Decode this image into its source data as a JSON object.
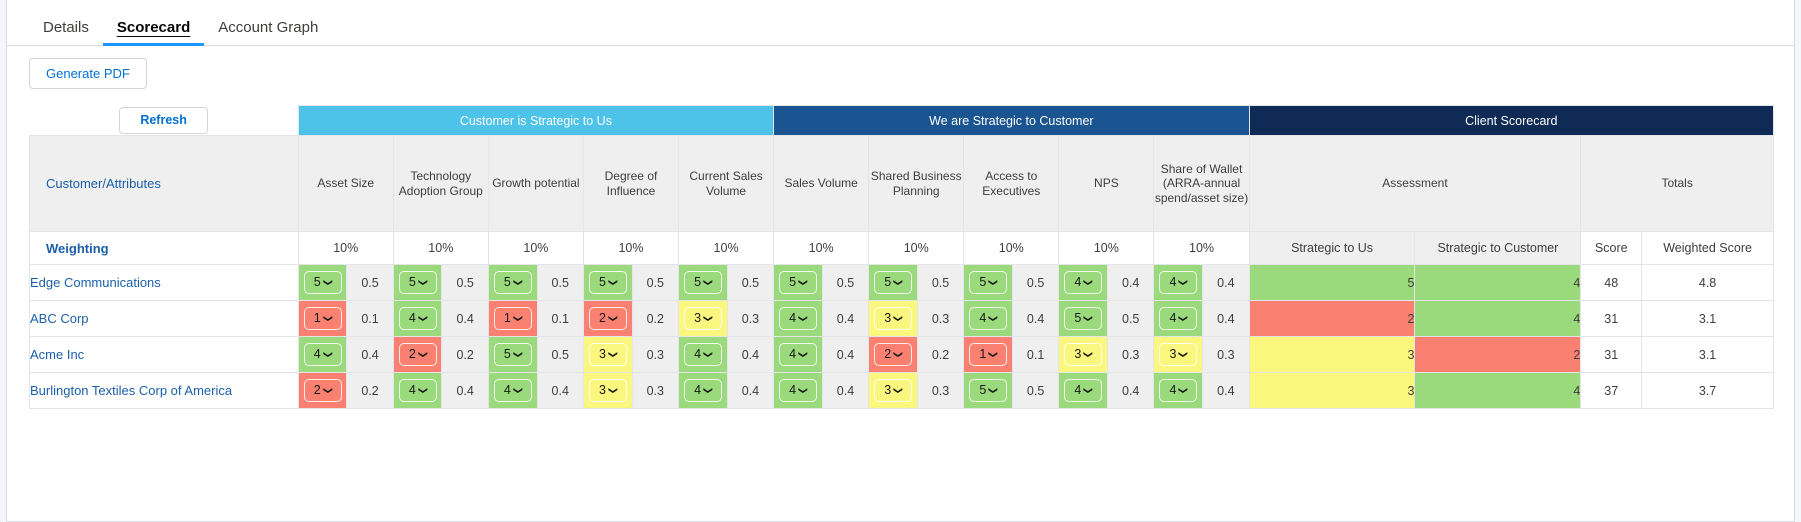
{
  "tabs": [
    {
      "label": "Details",
      "active": false
    },
    {
      "label": "Scorecard",
      "active": true
    },
    {
      "label": "Account Graph",
      "active": false
    }
  ],
  "toolbar": {
    "generate_pdf_label": "Generate PDF",
    "refresh_label": "Refresh"
  },
  "table": {
    "groups": [
      {
        "label": "Customer is Strategic to Us",
        "color": "#4dc3ea",
        "span": 10
      },
      {
        "label": "We are Strategic to Customer",
        "color": "#1a5491",
        "span": 10
      },
      {
        "label": "Client Scorecard",
        "color": "#0f2a55",
        "span": 4
      }
    ],
    "first_column_header": "Customer/Attributes",
    "attribute_columns": [
      "Asset Size",
      "Technology Adoption Group",
      "Growth potential",
      "Degree of Influence",
      "Current Sales Volume",
      "Sales Volume",
      "Shared Business Planning",
      "Access to Executives",
      "NPS",
      "Share of Wallet (ARRA-annual spend/asset size)"
    ],
    "assessment_header": "Assessment",
    "totals_header": "Totals",
    "weighting_row": {
      "label": "Weighting",
      "values": [
        "10%",
        "10%",
        "10%",
        "10%",
        "10%",
        "10%",
        "10%",
        "10%",
        "10%",
        "10%"
      ],
      "assessment_subheaders": [
        "Strategic to Us",
        "Strategic to Customer"
      ],
      "totals_subheaders": [
        "Score",
        "Weighted Score"
      ]
    },
    "rows": [
      {
        "customer": "Edge Communications",
        "scores": [
          {
            "v": "5",
            "c": "green",
            "w": "0.5"
          },
          {
            "v": "5",
            "c": "green",
            "w": "0.5"
          },
          {
            "v": "5",
            "c": "green",
            "w": "0.5"
          },
          {
            "v": "5",
            "c": "green",
            "w": "0.5"
          },
          {
            "v": "5",
            "c": "green",
            "w": "0.5"
          },
          {
            "v": "5",
            "c": "green",
            "w": "0.5"
          },
          {
            "v": "5",
            "c": "green",
            "w": "0.5"
          },
          {
            "v": "5",
            "c": "green",
            "w": "0.5"
          },
          {
            "v": "4",
            "c": "green",
            "w": "0.4"
          },
          {
            "v": "4",
            "c": "green",
            "w": "0.4"
          }
        ],
        "assessment": [
          {
            "v": "5",
            "c": "green"
          },
          {
            "v": "4",
            "c": "green"
          }
        ],
        "score": "48",
        "weighted_score": "4.8"
      },
      {
        "customer": "ABC Corp",
        "scores": [
          {
            "v": "1",
            "c": "red",
            "w": "0.1"
          },
          {
            "v": "4",
            "c": "green",
            "w": "0.4"
          },
          {
            "v": "1",
            "c": "red",
            "w": "0.1"
          },
          {
            "v": "2",
            "c": "red",
            "w": "0.2"
          },
          {
            "v": "3",
            "c": "yellow",
            "w": "0.3"
          },
          {
            "v": "4",
            "c": "green",
            "w": "0.4"
          },
          {
            "v": "3",
            "c": "yellow",
            "w": "0.3"
          },
          {
            "v": "4",
            "c": "green",
            "w": "0.4"
          },
          {
            "v": "5",
            "c": "green",
            "w": "0.5"
          },
          {
            "v": "4",
            "c": "green",
            "w": "0.4"
          }
        ],
        "assessment": [
          {
            "v": "2",
            "c": "red"
          },
          {
            "v": "4",
            "c": "green"
          }
        ],
        "score": "31",
        "weighted_score": "3.1"
      },
      {
        "customer": "Acme Inc",
        "scores": [
          {
            "v": "4",
            "c": "green",
            "w": "0.4"
          },
          {
            "v": "2",
            "c": "red",
            "w": "0.2"
          },
          {
            "v": "5",
            "c": "green",
            "w": "0.5"
          },
          {
            "v": "3",
            "c": "yellow",
            "w": "0.3"
          },
          {
            "v": "4",
            "c": "green",
            "w": "0.4"
          },
          {
            "v": "4",
            "c": "green",
            "w": "0.4"
          },
          {
            "v": "2",
            "c": "red",
            "w": "0.2"
          },
          {
            "v": "1",
            "c": "red",
            "w": "0.1"
          },
          {
            "v": "3",
            "c": "yellow",
            "w": "0.3"
          },
          {
            "v": "3",
            "c": "yellow",
            "w": "0.3"
          }
        ],
        "assessment": [
          {
            "v": "3",
            "c": "yellow"
          },
          {
            "v": "2",
            "c": "red"
          }
        ],
        "score": "31",
        "weighted_score": "3.1"
      },
      {
        "customer": "Burlington Textiles Corp of America",
        "scores": [
          {
            "v": "2",
            "c": "red",
            "w": "0.2"
          },
          {
            "v": "4",
            "c": "green",
            "w": "0.4"
          },
          {
            "v": "4",
            "c": "green",
            "w": "0.4"
          },
          {
            "v": "3",
            "c": "yellow",
            "w": "0.3"
          },
          {
            "v": "4",
            "c": "green",
            "w": "0.4"
          },
          {
            "v": "4",
            "c": "green",
            "w": "0.4"
          },
          {
            "v": "3",
            "c": "yellow",
            "w": "0.3"
          },
          {
            "v": "5",
            "c": "green",
            "w": "0.5"
          },
          {
            "v": "4",
            "c": "green",
            "w": "0.4"
          },
          {
            "v": "4",
            "c": "green",
            "w": "0.4"
          }
        ],
        "assessment": [
          {
            "v": "3",
            "c": "yellow"
          },
          {
            "v": "4",
            "c": "green"
          }
        ],
        "score": "37",
        "weighted_score": "3.7"
      }
    ]
  },
  "colors": {
    "green": "#9ada7c",
    "yellow": "#fbf77e",
    "red": "#fa8072",
    "link": "#1b5faa",
    "accent": "#1b96ff"
  }
}
